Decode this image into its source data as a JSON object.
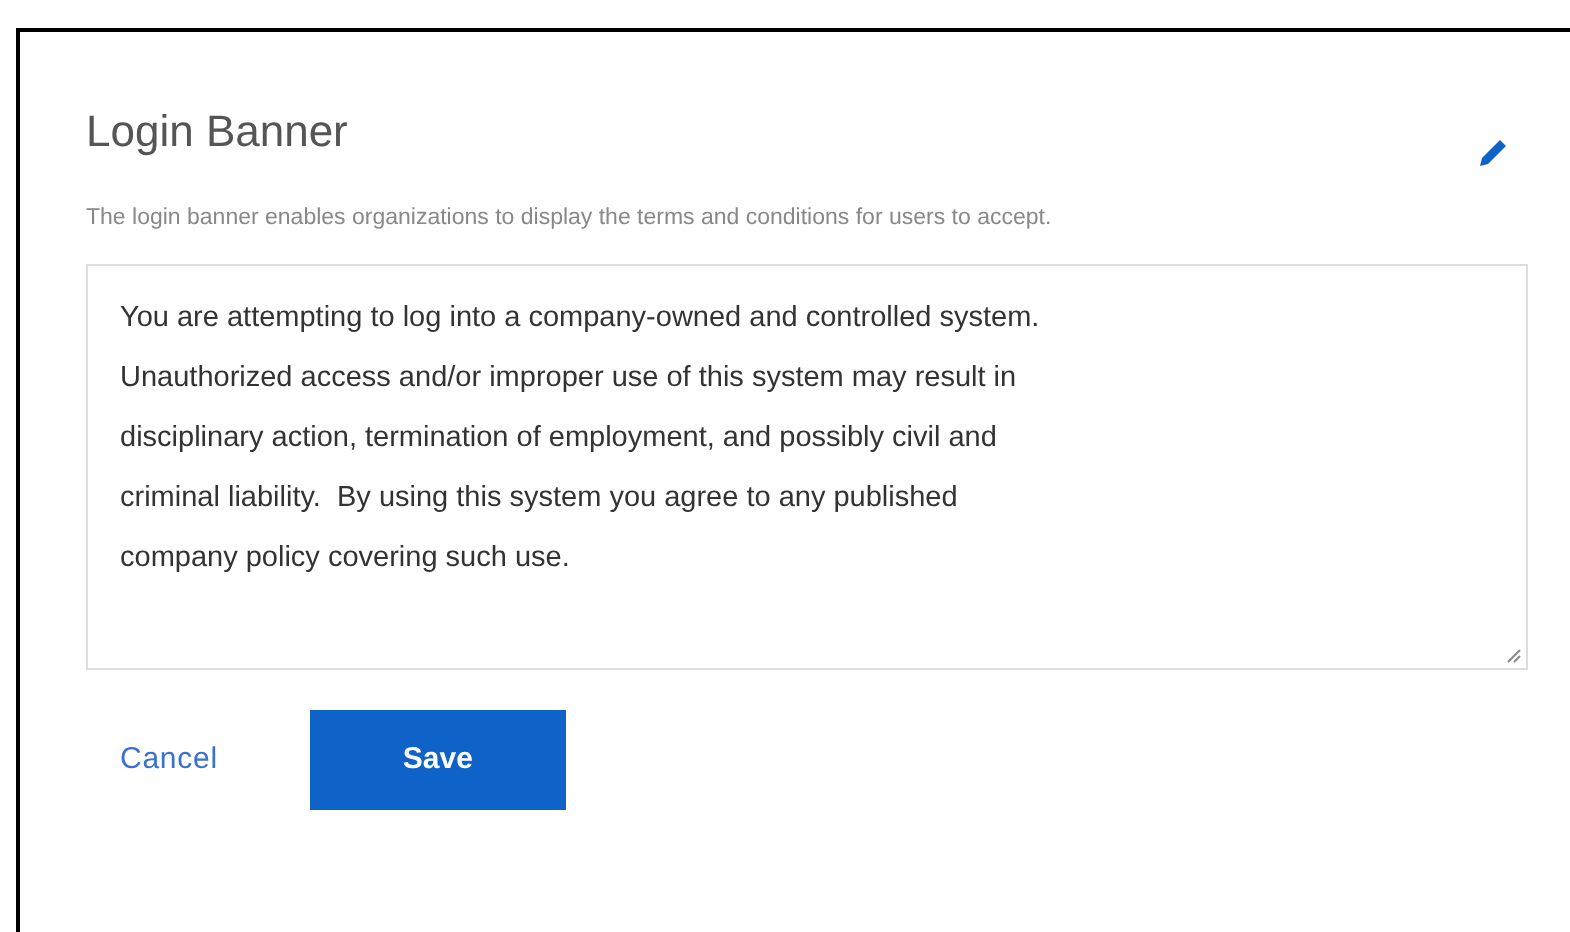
{
  "card": {
    "title": "Login Banner",
    "description": "The login banner enables organizations to display the terms and conditions for users to accept.",
    "banner_text": {
      "value": "You are attempting to log into a company-owned and controlled system.\nUnauthorized access and/or improper use of this system may result in\ndisciplinary action, termination of employment, and possibly civil and\ncriminal liability.  By using this system you agree to any published\ncompany policy covering such use."
    },
    "buttons": [
      {
        "kind": "link",
        "label": "Cancel"
      },
      {
        "kind": "primary",
        "label": "Save"
      }
    ]
  }
}
